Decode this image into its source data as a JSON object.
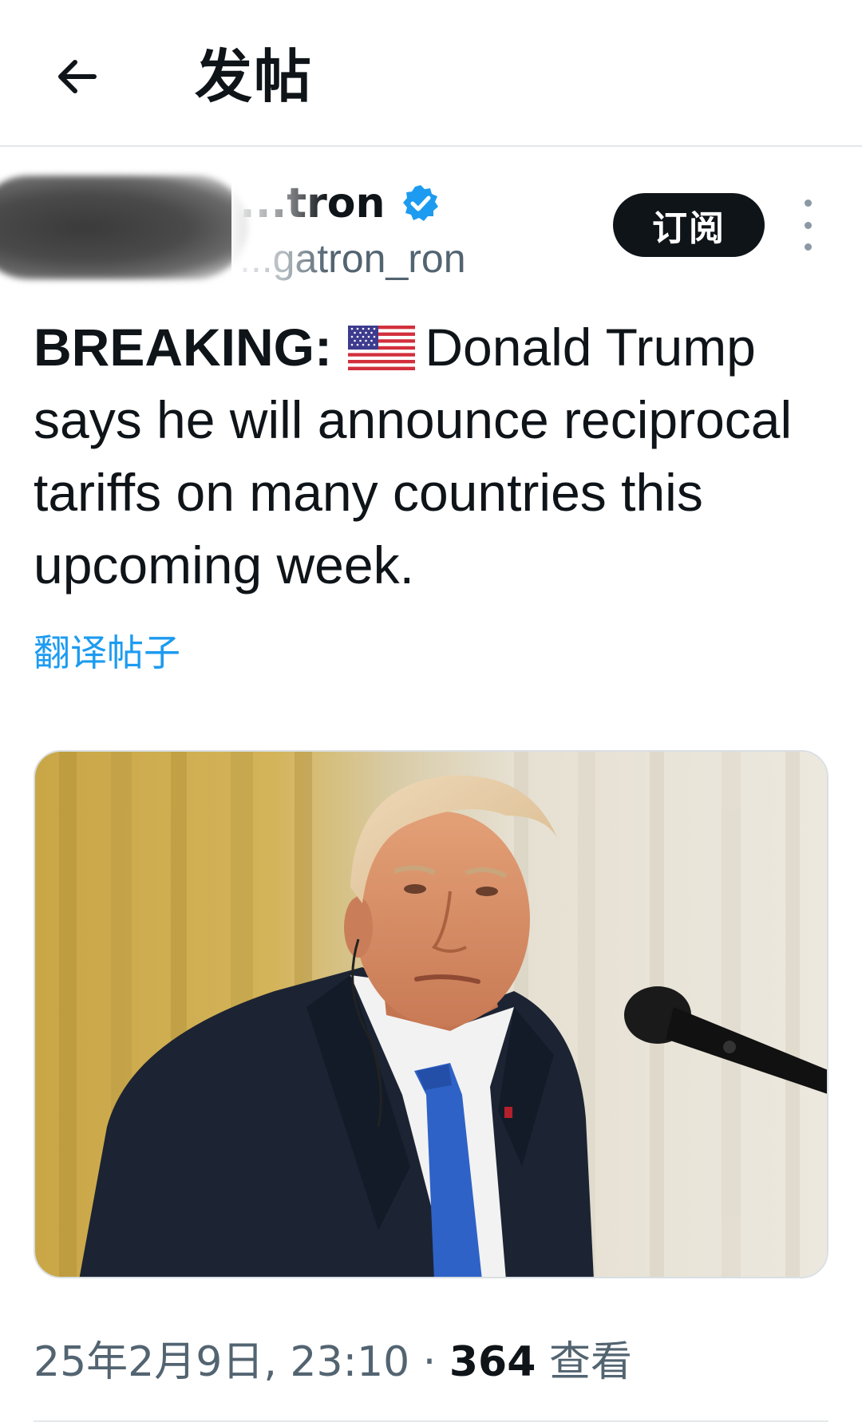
{
  "header": {
    "title": "发帖",
    "back_icon": "arrow-left-icon"
  },
  "author": {
    "display_name": "...tron",
    "handle": "...gatron_ron",
    "verified_icon": "verified-badge-icon",
    "verified_color": "#1d9bf0",
    "subscribe_label": "订阅",
    "more_icon": "more-vertical-icon"
  },
  "tweet": {
    "prefix": "BREAKING:",
    "flag_icon": "us-flag-icon",
    "body": "Donald Trump says he will announce reciprocal tariffs on many countries this upcoming week.",
    "translate_label": "翻译帖子",
    "link_color": "#1d9bf0"
  },
  "media": {
    "kind": "photo",
    "icon": "photo-icon"
  },
  "meta": {
    "timestamp": "25年2月9日, 23:10",
    "separator": "·",
    "views_count": "364",
    "views_label": "查看"
  }
}
